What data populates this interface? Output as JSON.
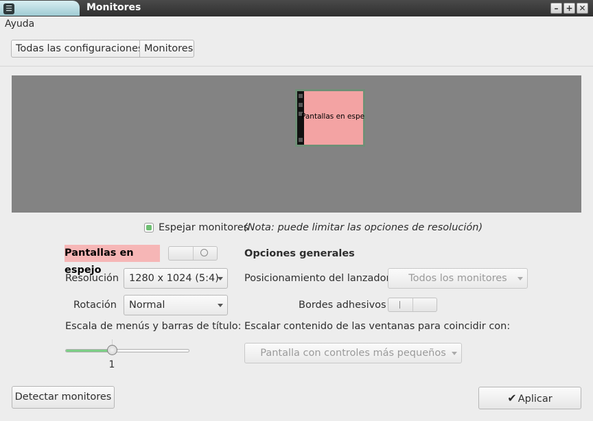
{
  "window": {
    "title": "Monitores",
    "minimize_label": "–",
    "maximize_label": "+",
    "close_label": "✕"
  },
  "menubar": {
    "items": [
      "Ayuda"
    ]
  },
  "breadcrumb": {
    "items": [
      "Todas las configuraciones",
      "Monitores"
    ]
  },
  "preview": {
    "monitor_label": "Pantallas en espejo"
  },
  "mirror": {
    "checked": true,
    "label": "Espejar monitores",
    "note": "(Nota: puede limitar las opciones de resolución)"
  },
  "display_settings": {
    "title": "Pantallas en espejo",
    "enabled": false,
    "resolution_label": "Resolución",
    "resolution_value": "1280 x 1024 (5:4)",
    "rotation_label": "Rotación",
    "rotation_value": "Normal",
    "scale_label": "Escala de menús y barras de título:",
    "scale_value": "1",
    "scale_fraction": 0.375
  },
  "general": {
    "title": "Opciones generales",
    "launcher_label": "Posicionamiento del lanzador",
    "launcher_value": "Todos los monitores",
    "sticky_label": "Bordes adhesivos",
    "sticky_enabled": false,
    "scale_windows_label": "Escalar contenido de las ventanas para coincidir con:",
    "scale_windows_value": "Pantalla con controles más pequeños"
  },
  "actions": {
    "detect_label": "Detectar monitores",
    "apply_label": "Aplicar"
  },
  "colors": {
    "accent": "#7dcf86",
    "monitor_fill": "#f3a3a3",
    "preview_bg": "#838383"
  }
}
